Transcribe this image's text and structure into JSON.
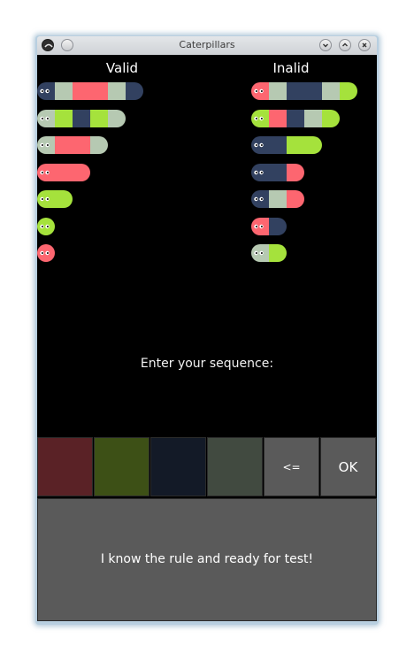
{
  "window": {
    "title": "Caterpillars"
  },
  "columns": {
    "valid_label": "Valid",
    "invalid_label": "Inalid"
  },
  "palette": {
    "navy": "#324160",
    "sage": "#b6c9b2",
    "red": "#fd6670",
    "lime": "#a5e23c"
  },
  "valid_caterpillars": [
    [
      "navy",
      "sage",
      "red",
      "red",
      "sage",
      "navy"
    ],
    [
      "sage",
      "lime",
      "navy",
      "lime",
      "sage"
    ],
    [
      "sage",
      "red",
      "red",
      "sage"
    ],
    [
      "red",
      "red",
      "red"
    ],
    [
      "lime",
      "lime"
    ],
    [
      "lime"
    ],
    [
      "red"
    ]
  ],
  "invalid_caterpillars": [
    [
      "red",
      "sage",
      "navy",
      "navy",
      "sage",
      "lime"
    ],
    [
      "lime",
      "red",
      "navy",
      "sage",
      "lime"
    ],
    [
      "navy",
      "navy",
      "lime",
      "lime"
    ],
    [
      "navy",
      "navy",
      "red"
    ],
    [
      "navy",
      "sage",
      "red"
    ],
    [
      "red",
      "navy"
    ],
    [
      "sage",
      "lime"
    ]
  ],
  "prompt": "Enter your sequence:",
  "color_buttons": [
    {
      "name": "red",
      "color": "#5a2226"
    },
    {
      "name": "lime",
      "color": "#3d5016"
    },
    {
      "name": "navy",
      "color": "#131a27"
    },
    {
      "name": "sage",
      "color": "#414a40"
    }
  ],
  "backspace_label": "<=",
  "ok_label": "OK",
  "test_button_label": "I know the rule and ready for test!"
}
